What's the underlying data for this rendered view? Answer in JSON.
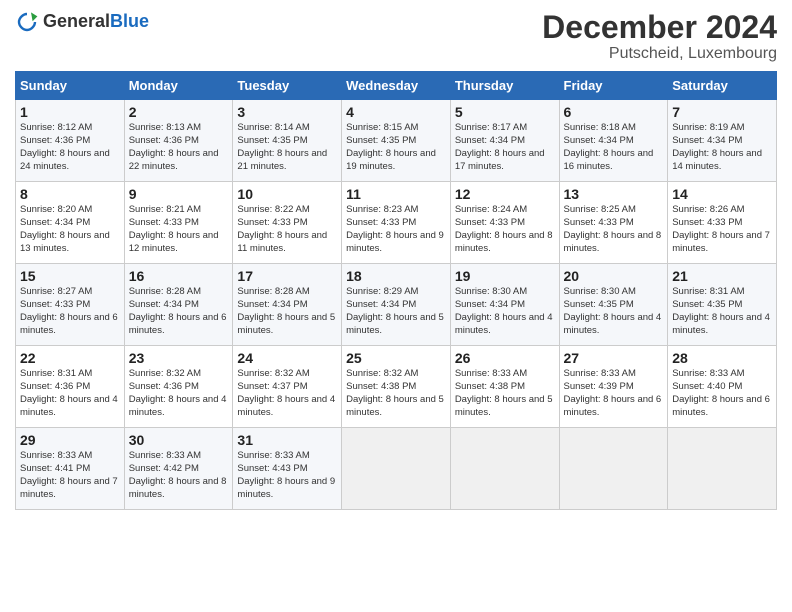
{
  "header": {
    "logo_general": "General",
    "logo_blue": "Blue",
    "month": "December 2024",
    "location": "Putscheid, Luxembourg"
  },
  "days_of_week": [
    "Sunday",
    "Monday",
    "Tuesday",
    "Wednesday",
    "Thursday",
    "Friday",
    "Saturday"
  ],
  "weeks": [
    [
      {
        "day": "1",
        "sunrise": "Sunrise: 8:12 AM",
        "sunset": "Sunset: 4:36 PM",
        "daylight": "Daylight: 8 hours and 24 minutes."
      },
      {
        "day": "2",
        "sunrise": "Sunrise: 8:13 AM",
        "sunset": "Sunset: 4:36 PM",
        "daylight": "Daylight: 8 hours and 22 minutes."
      },
      {
        "day": "3",
        "sunrise": "Sunrise: 8:14 AM",
        "sunset": "Sunset: 4:35 PM",
        "daylight": "Daylight: 8 hours and 21 minutes."
      },
      {
        "day": "4",
        "sunrise": "Sunrise: 8:15 AM",
        "sunset": "Sunset: 4:35 PM",
        "daylight": "Daylight: 8 hours and 19 minutes."
      },
      {
        "day": "5",
        "sunrise": "Sunrise: 8:17 AM",
        "sunset": "Sunset: 4:34 PM",
        "daylight": "Daylight: 8 hours and 17 minutes."
      },
      {
        "day": "6",
        "sunrise": "Sunrise: 8:18 AM",
        "sunset": "Sunset: 4:34 PM",
        "daylight": "Daylight: 8 hours and 16 minutes."
      },
      {
        "day": "7",
        "sunrise": "Sunrise: 8:19 AM",
        "sunset": "Sunset: 4:34 PM",
        "daylight": "Daylight: 8 hours and 14 minutes."
      }
    ],
    [
      {
        "day": "8",
        "sunrise": "Sunrise: 8:20 AM",
        "sunset": "Sunset: 4:34 PM",
        "daylight": "Daylight: 8 hours and 13 minutes."
      },
      {
        "day": "9",
        "sunrise": "Sunrise: 8:21 AM",
        "sunset": "Sunset: 4:33 PM",
        "daylight": "Daylight: 8 hours and 12 minutes."
      },
      {
        "day": "10",
        "sunrise": "Sunrise: 8:22 AM",
        "sunset": "Sunset: 4:33 PM",
        "daylight": "Daylight: 8 hours and 11 minutes."
      },
      {
        "day": "11",
        "sunrise": "Sunrise: 8:23 AM",
        "sunset": "Sunset: 4:33 PM",
        "daylight": "Daylight: 8 hours and 9 minutes."
      },
      {
        "day": "12",
        "sunrise": "Sunrise: 8:24 AM",
        "sunset": "Sunset: 4:33 PM",
        "daylight": "Daylight: 8 hours and 8 minutes."
      },
      {
        "day": "13",
        "sunrise": "Sunrise: 8:25 AM",
        "sunset": "Sunset: 4:33 PM",
        "daylight": "Daylight: 8 hours and 8 minutes."
      },
      {
        "day": "14",
        "sunrise": "Sunrise: 8:26 AM",
        "sunset": "Sunset: 4:33 PM",
        "daylight": "Daylight: 8 hours and 7 minutes."
      }
    ],
    [
      {
        "day": "15",
        "sunrise": "Sunrise: 8:27 AM",
        "sunset": "Sunset: 4:33 PM",
        "daylight": "Daylight: 8 hours and 6 minutes."
      },
      {
        "day": "16",
        "sunrise": "Sunrise: 8:28 AM",
        "sunset": "Sunset: 4:34 PM",
        "daylight": "Daylight: 8 hours and 6 minutes."
      },
      {
        "day": "17",
        "sunrise": "Sunrise: 8:28 AM",
        "sunset": "Sunset: 4:34 PM",
        "daylight": "Daylight: 8 hours and 5 minutes."
      },
      {
        "day": "18",
        "sunrise": "Sunrise: 8:29 AM",
        "sunset": "Sunset: 4:34 PM",
        "daylight": "Daylight: 8 hours and 5 minutes."
      },
      {
        "day": "19",
        "sunrise": "Sunrise: 8:30 AM",
        "sunset": "Sunset: 4:34 PM",
        "daylight": "Daylight: 8 hours and 4 minutes."
      },
      {
        "day": "20",
        "sunrise": "Sunrise: 8:30 AM",
        "sunset": "Sunset: 4:35 PM",
        "daylight": "Daylight: 8 hours and 4 minutes."
      },
      {
        "day": "21",
        "sunrise": "Sunrise: 8:31 AM",
        "sunset": "Sunset: 4:35 PM",
        "daylight": "Daylight: 8 hours and 4 minutes."
      }
    ],
    [
      {
        "day": "22",
        "sunrise": "Sunrise: 8:31 AM",
        "sunset": "Sunset: 4:36 PM",
        "daylight": "Daylight: 8 hours and 4 minutes."
      },
      {
        "day": "23",
        "sunrise": "Sunrise: 8:32 AM",
        "sunset": "Sunset: 4:36 PM",
        "daylight": "Daylight: 8 hours and 4 minutes."
      },
      {
        "day": "24",
        "sunrise": "Sunrise: 8:32 AM",
        "sunset": "Sunset: 4:37 PM",
        "daylight": "Daylight: 8 hours and 4 minutes."
      },
      {
        "day": "25",
        "sunrise": "Sunrise: 8:32 AM",
        "sunset": "Sunset: 4:38 PM",
        "daylight": "Daylight: 8 hours and 5 minutes."
      },
      {
        "day": "26",
        "sunrise": "Sunrise: 8:33 AM",
        "sunset": "Sunset: 4:38 PM",
        "daylight": "Daylight: 8 hours and 5 minutes."
      },
      {
        "day": "27",
        "sunrise": "Sunrise: 8:33 AM",
        "sunset": "Sunset: 4:39 PM",
        "daylight": "Daylight: 8 hours and 6 minutes."
      },
      {
        "day": "28",
        "sunrise": "Sunrise: 8:33 AM",
        "sunset": "Sunset: 4:40 PM",
        "daylight": "Daylight: 8 hours and 6 minutes."
      }
    ],
    [
      {
        "day": "29",
        "sunrise": "Sunrise: 8:33 AM",
        "sunset": "Sunset: 4:41 PM",
        "daylight": "Daylight: 8 hours and 7 minutes."
      },
      {
        "day": "30",
        "sunrise": "Sunrise: 8:33 AM",
        "sunset": "Sunset: 4:42 PM",
        "daylight": "Daylight: 8 hours and 8 minutes."
      },
      {
        "day": "31",
        "sunrise": "Sunrise: 8:33 AM",
        "sunset": "Sunset: 4:43 PM",
        "daylight": "Daylight: 8 hours and 9 minutes."
      },
      null,
      null,
      null,
      null
    ]
  ]
}
